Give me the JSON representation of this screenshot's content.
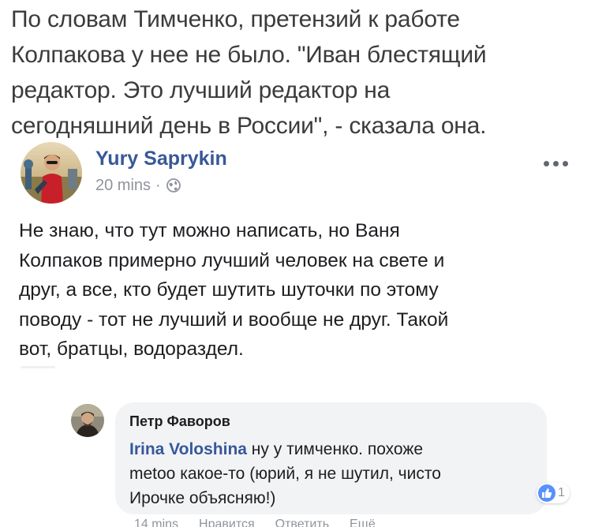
{
  "article": {
    "lines": [
      "По словам Тимченко, претензий к работе",
      "Колпакова у нее не было. \"Иван блестящий",
      "редактор. Это лучший редактор на",
      "сегодняшний день в России\", - сказала она."
    ]
  },
  "post": {
    "author": "Yury Saprykin",
    "time": "20 mins",
    "separator": "·",
    "privacy_icon": "globe-icon",
    "more_icon": "more-options-icon",
    "body_lines": [
      "Не знаю, что тут можно написать, но Ваня",
      "Колпаков примерно лучший человек на свете и",
      "друг, а все, кто будет шутить шуточки по этому",
      "поводу - тот не лучший и вообще не друг. Такой",
      "вот, братцы, водораздел."
    ]
  },
  "comment": {
    "author": "Петр Фаворов",
    "mention": "Irina Voloshina",
    "text_first": " ну у тимченко. похоже",
    "text_lines": [
      "metoo какое-то (юрий, я не шутил, чисто",
      "Ирочке объясняю!)"
    ],
    "reaction_icon": "like-icon",
    "reaction_count": "1",
    "actions": [
      "14 mins",
      "Нравится",
      "Ответить",
      "Ещё"
    ]
  },
  "colors": {
    "link_blue": "#385898",
    "meta_gray": "#90949c",
    "bubble_bg": "#f2f3f5",
    "like_blue": "#5890ff",
    "text": "#1c1e21"
  }
}
